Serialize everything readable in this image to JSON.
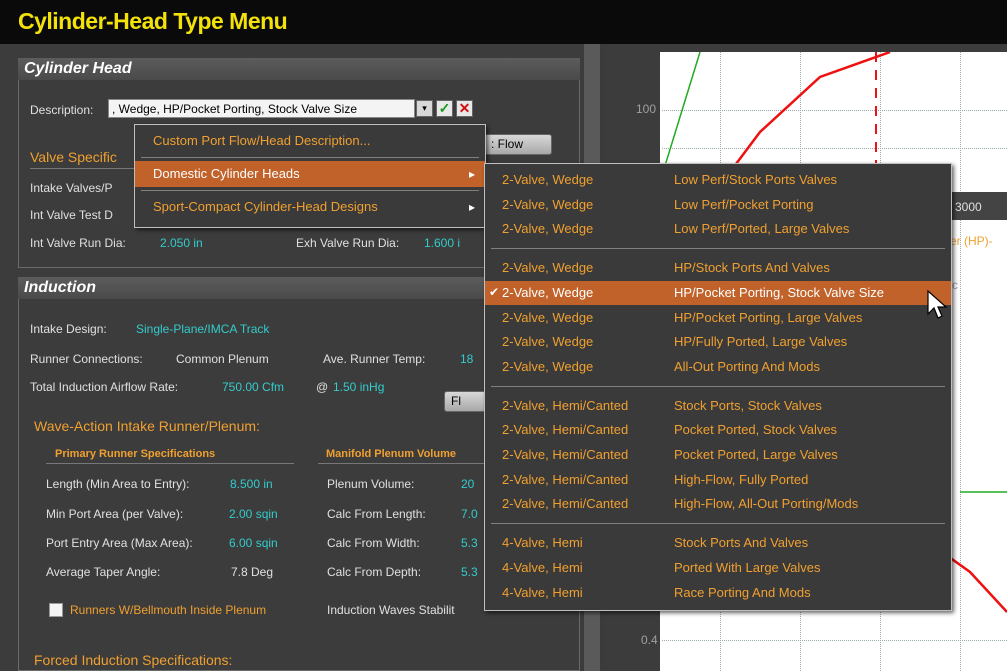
{
  "title": "Cylinder-Head Type Menu",
  "cylinder_head": {
    "header": "Cylinder Head",
    "description_label": "Description:",
    "description_value": ", Wedge, HP/Pocket Porting, Stock Valve Size",
    "valve_spec_label": "Valve Specific",
    "intake_valves_label": "Intake Valves/P",
    "int_valve_test_label": "Int Valve Test D",
    "int_valve_run_label": "Int Valve Run Dia:",
    "int_valve_run_value": "2.050 in",
    "exh_valve_run_label": "Exh Valve Run Dia:",
    "exh_valve_run_value": "1.600 i",
    "flow_button": ": Flow"
  },
  "induction": {
    "header": "Induction",
    "intake_design_label": "Intake Design:",
    "intake_design_value": "Single-Plane/IMCA Track",
    "runner_conn_label": "Runner Connections:",
    "runner_conn_value": "Common Plenum",
    "ave_runner_temp_label": "Ave. Runner Temp:",
    "ave_runner_temp_value": "18",
    "airflow_label": "Total Induction Airflow Rate:",
    "airflow_value": "750.00 Cfm",
    "airflow_at_label": "@",
    "airflow_at_value": "1.50 inHg",
    "fl_button": "Fl",
    "wave_action_label": "Wave-Action Intake Runner/Plenum:",
    "primary_runner_header": "Primary Runner Specifications",
    "manifold_plenum_header": "Manifold Plenum Volume",
    "length_label": "Length (Min Area to Entry):",
    "length_value": "8.500 in",
    "min_port_label": "Min Port Area (per Valve):",
    "min_port_value": "2.00 sqin",
    "port_entry_label": "Port Entry Area (Max Area):",
    "port_entry_value": "6.00 sqin",
    "taper_label": "Average Taper Angle:",
    "taper_value": "7.8 Deg",
    "plenum_volume_label": "Plenum Volume:",
    "plenum_volume_value": "20",
    "calc_length_label": "Calc From Length:",
    "calc_length_value": "7.0",
    "calc_width_label": "Calc From Width:",
    "calc_width_value": "5.3",
    "calc_depth_label": "Calc From Depth:",
    "calc_depth_value": "5.3",
    "bellmouth_label": "Runners W/Bellmouth Inside Plenum",
    "waves_stability_label": "Induction Waves Stabilit",
    "forced_induction_label": "Forced Induction Specifications:"
  },
  "chart": {
    "y_label_100": "100",
    "y_label_04": "0.4",
    "x_label_3000": "3000",
    "power_label": "ver (HP)-",
    "c_label": "c"
  },
  "context_menu": {
    "items": [
      {
        "label": "Custom Port Flow/Head Description...",
        "has_submenu": false,
        "highlighted": false
      },
      {
        "label": "Domestic Cylinder Heads",
        "has_submenu": true,
        "highlighted": true
      },
      {
        "label": "Sport-Compact Cylinder-Head Designs",
        "has_submenu": true,
        "highlighted": false
      }
    ]
  },
  "submenu": {
    "groups": [
      [
        {
          "type": "2-Valve, Wedge",
          "desc": "Low Perf/Stock Ports  Valves",
          "checked": false,
          "highlighted": false
        },
        {
          "type": "2-Valve, Wedge",
          "desc": "Low Perf/Pocket Porting",
          "checked": false,
          "highlighted": false
        },
        {
          "type": "2-Valve, Wedge",
          "desc": "Low Perf/Ported, Large Valves",
          "checked": false,
          "highlighted": false
        }
      ],
      [
        {
          "type": "2-Valve, Wedge",
          "desc": "HP/Stock Ports And Valves",
          "checked": false,
          "highlighted": false
        },
        {
          "type": "2-Valve, Wedge",
          "desc": "HP/Pocket Porting, Stock Valve Size",
          "checked": true,
          "highlighted": true
        },
        {
          "type": "2-Valve, Wedge",
          "desc": "HP/Pocket Porting, Large Valves",
          "checked": false,
          "highlighted": false
        },
        {
          "type": "2-Valve, Wedge",
          "desc": "HP/Fully Ported, Large Valves",
          "checked": false,
          "highlighted": false
        },
        {
          "type": "2-Valve, Wedge",
          "desc": "All-Out Porting And Mods",
          "checked": false,
          "highlighted": false
        }
      ],
      [
        {
          "type": "2-Valve, Hemi/Canted",
          "desc": "Stock Ports, Stock Valves",
          "checked": false,
          "highlighted": false
        },
        {
          "type": "2-Valve, Hemi/Canted",
          "desc": "Pocket Ported, Stock Valves",
          "checked": false,
          "highlighted": false
        },
        {
          "type": "2-Valve, Hemi/Canted",
          "desc": "Pocket Ported, Large Valves",
          "checked": false,
          "highlighted": false
        },
        {
          "type": "2-Valve, Hemi/Canted",
          "desc": "High-Flow, Fully Ported",
          "checked": false,
          "highlighted": false
        },
        {
          "type": "2-Valve, Hemi/Canted",
          "desc": "High-Flow, All-Out Porting/Mods",
          "checked": false,
          "highlighted": false
        }
      ],
      [
        {
          "type": "4-Valve, Hemi",
          "desc": "Stock Ports And Valves",
          "checked": false,
          "highlighted": false
        },
        {
          "type": "4-Valve, Hemi",
          "desc": "Ported With Large Valves",
          "checked": false,
          "highlighted": false
        },
        {
          "type": "4-Valve, Hemi",
          "desc": "Race Porting And Mods",
          "checked": false,
          "highlighted": false
        }
      ]
    ]
  },
  "colors": {
    "title_yellow": "#f2e20a",
    "menu_orange_text": "#f0a030",
    "highlight": "#c0622a",
    "value_cyan": "#33cccc"
  },
  "icons": {
    "dropdown": "dropdown-arrow-icon",
    "accept": "check-icon",
    "cancel": "close-icon",
    "submenu": "submenu-arrow-icon",
    "checkmark": "checkmark-icon",
    "cursor": "mouse-pointer-icon"
  }
}
